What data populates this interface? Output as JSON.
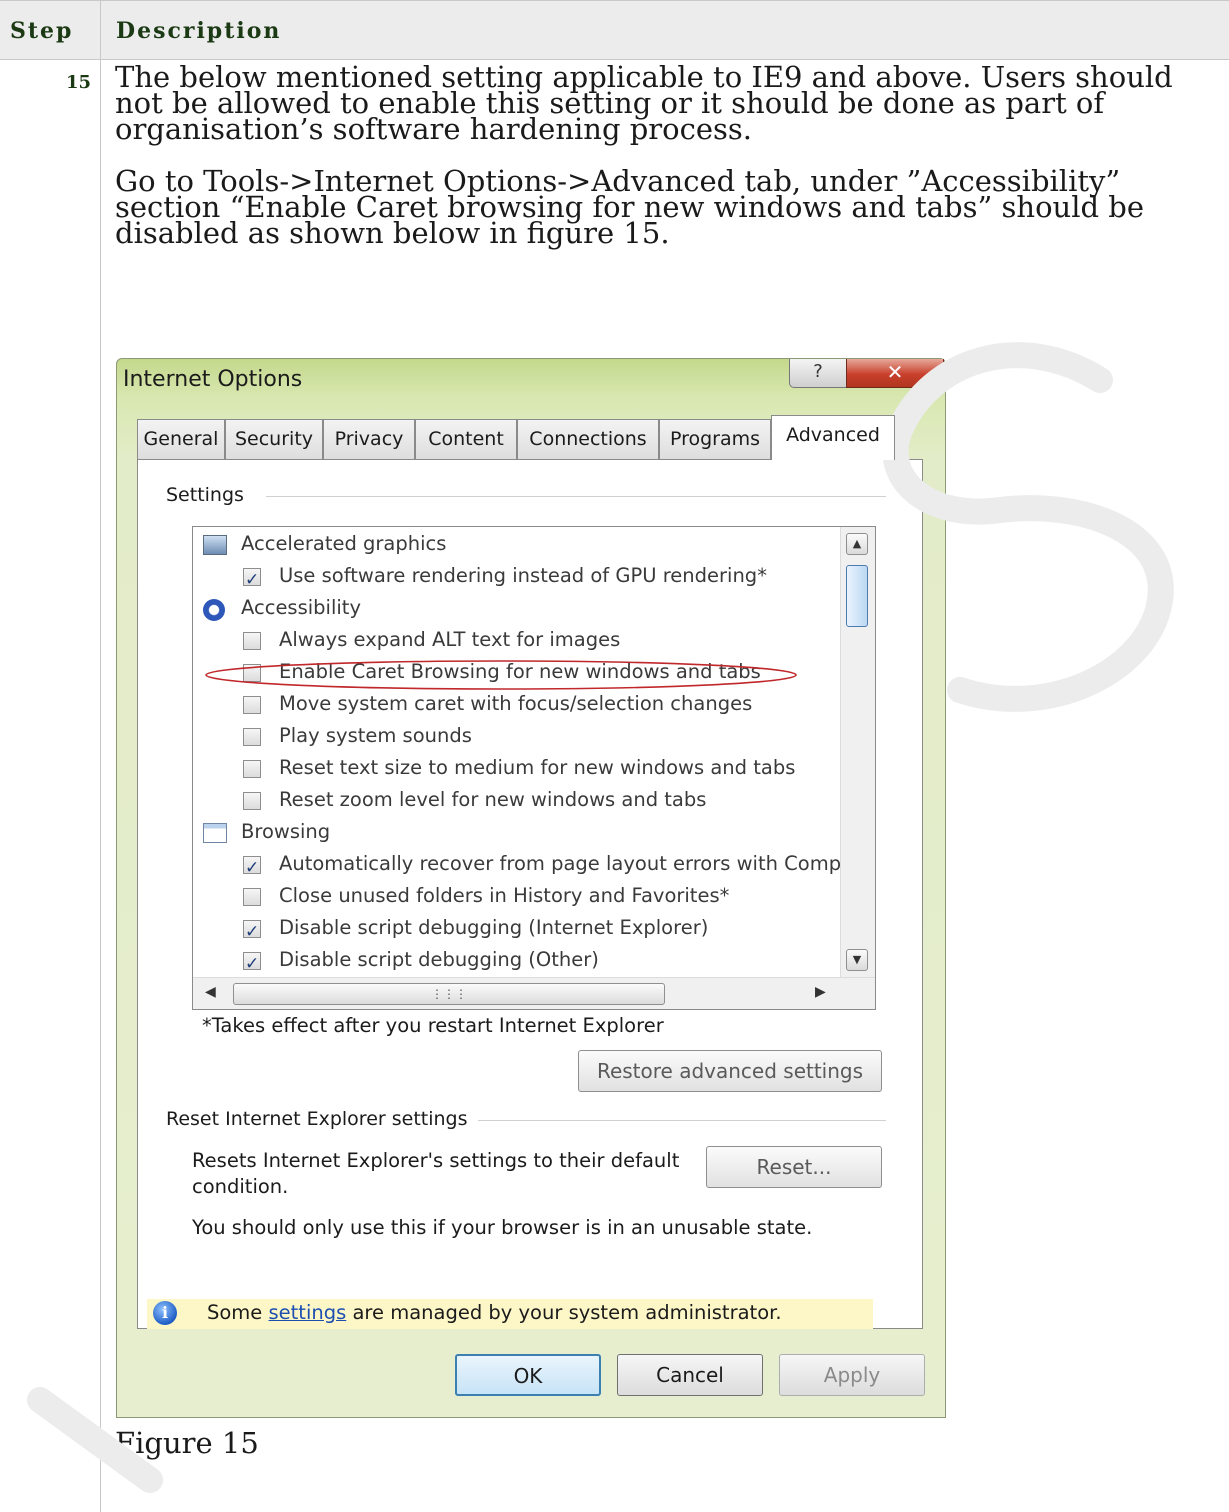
{
  "table": {
    "header_step": "Step",
    "header_description": "Description",
    "step_number": "15",
    "paragraph1": "The below mentioned setting applicable to IE9 and above. Users should not be allowed to enable this setting or it should be done as part of organisation’s software hardening process.",
    "paragraph2": "Go to Tools->Internet Options->Advanced tab, under ”Accessibility” section “Enable Caret browsing for new windows and tabs” should be disabled as shown below in figure 15.",
    "figure_caption": "Figure 15"
  },
  "dialog": {
    "title": "Internet Options",
    "help_glyph": "?",
    "close_glyph": "✕",
    "tabs": [
      "General",
      "Security",
      "Privacy",
      "Content",
      "Connections",
      "Programs",
      "Advanced"
    ],
    "active_tab": "Advanced",
    "settings_label": "Settings",
    "settings": [
      {
        "kind": "category",
        "label": "Accelerated graphics",
        "icon": "monitor-icon"
      },
      {
        "kind": "checkbox",
        "label": "Use software rendering instead of GPU rendering*",
        "checked": true
      },
      {
        "kind": "category",
        "label": "Accessibility",
        "icon": "accessibility-icon"
      },
      {
        "kind": "checkbox",
        "label": "Always expand ALT text for images",
        "checked": false
      },
      {
        "kind": "checkbox",
        "label": "Enable Caret Browsing for new windows and tabs",
        "checked": false,
        "circled": true
      },
      {
        "kind": "checkbox",
        "label": "Move system caret with focus/selection changes",
        "checked": false
      },
      {
        "kind": "checkbox",
        "label": "Play system sounds",
        "checked": false
      },
      {
        "kind": "checkbox",
        "label": "Reset text size to medium for new windows and tabs",
        "checked": false
      },
      {
        "kind": "checkbox",
        "label": "Reset zoom level for new windows and tabs",
        "checked": false
      },
      {
        "kind": "category",
        "label": "Browsing",
        "icon": "window-icon"
      },
      {
        "kind": "checkbox",
        "label": "Automatically recover from page layout errors with Compa",
        "checked": true
      },
      {
        "kind": "checkbox",
        "label": "Close unused folders in History and Favorites*",
        "checked": false
      },
      {
        "kind": "checkbox",
        "label": "Disable script debugging (Internet Explorer)",
        "checked": true
      },
      {
        "kind": "checkbox",
        "label": "Disable script debugging (Other)",
        "checked": true
      }
    ],
    "restart_note": "*Takes effect after you restart Internet Explorer",
    "restore_button": "Restore advanced settings",
    "reset_group_label": "Reset Internet Explorer settings",
    "reset_text": "Resets Internet Explorer's settings to their default condition.",
    "reset_button": "Reset...",
    "unusable_text": "You should only use this if your browser is in an unusable state.",
    "info_prefix": "Some ",
    "info_link": "settings",
    "info_suffix": " are managed by your system administrator.",
    "ok_button": "OK",
    "cancel_button": "Cancel",
    "apply_button": "Apply"
  }
}
